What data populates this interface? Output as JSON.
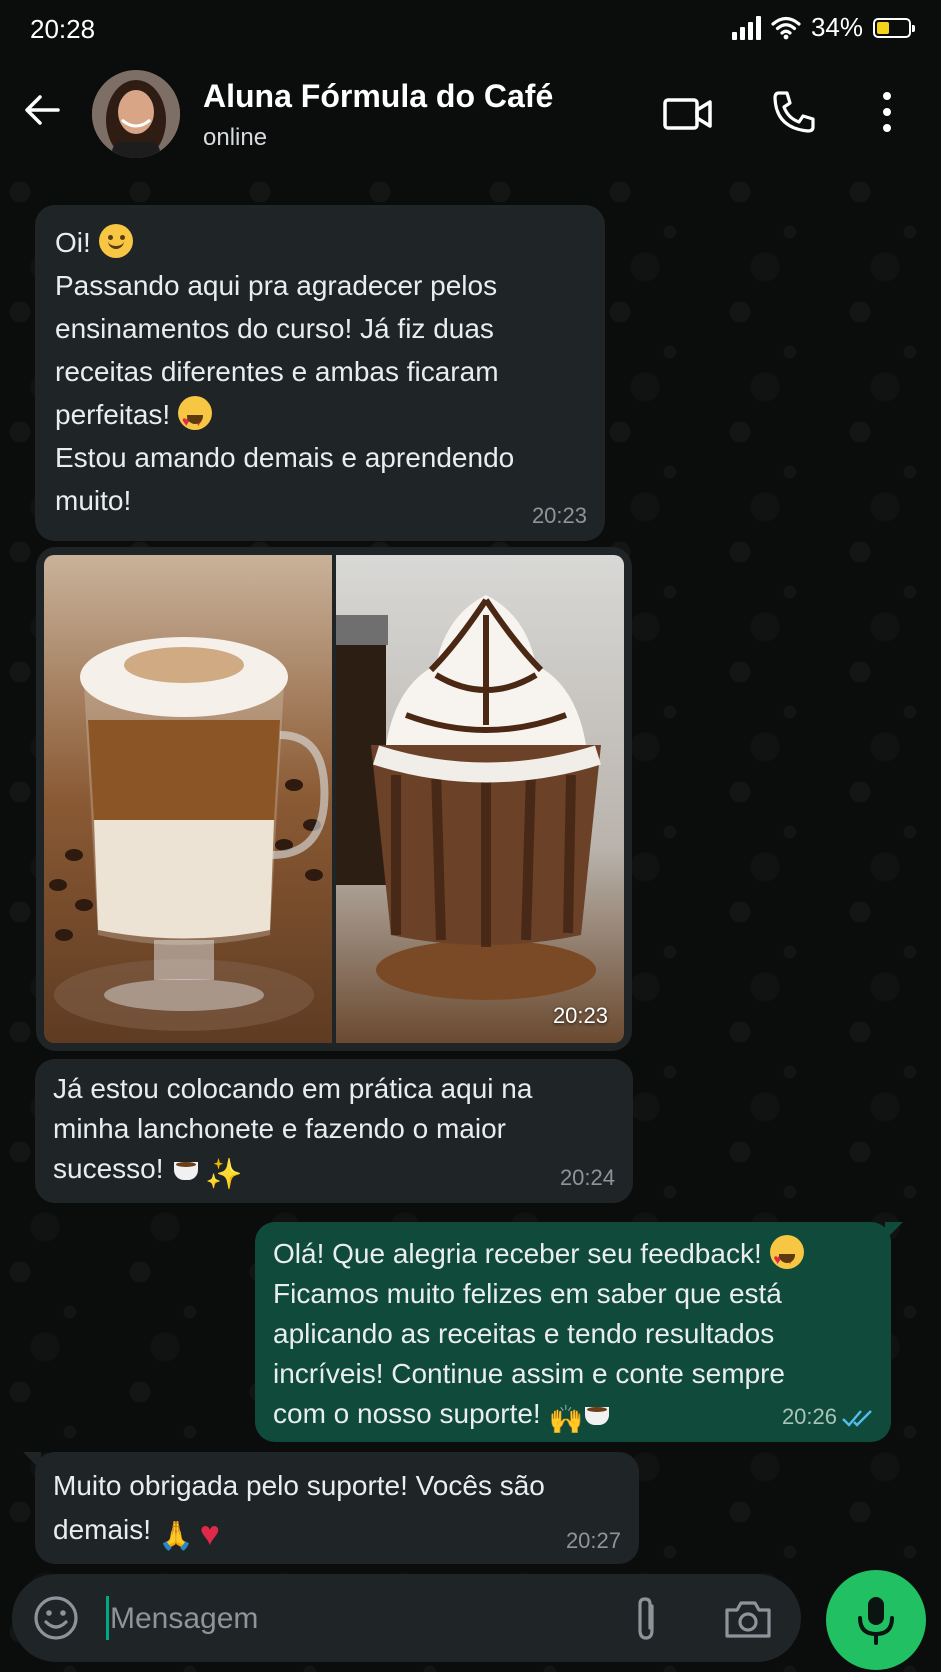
{
  "status_bar": {
    "time": "20:28",
    "battery": "34%"
  },
  "header": {
    "contact_name": "Aluna Fórmula do Café",
    "contact_status": "online"
  },
  "messages": [
    {
      "direction": "incoming",
      "lines": [
        "Oi!",
        "Passando aqui pra agradecer pelos",
        "ensinamentos do curso! Já fiz duas",
        "receitas diferentes e ambas ficaram",
        "perfeitas!",
        "Estou amando demais e aprendendo",
        "muito!"
      ],
      "time": "20:23"
    },
    {
      "direction": "incoming",
      "type": "photos",
      "time": "20:23",
      "photos": [
        "layered latte in glass mug",
        "mocha with whipped cream and chocolate"
      ]
    },
    {
      "direction": "incoming",
      "lines": [
        "Já estou colocando em prática aqui na",
        "minha lanchonete e fazendo o maior",
        "sucesso!"
      ],
      "time": "20:24"
    },
    {
      "direction": "outgoing",
      "lines": [
        "Olá! Que alegria receber seu feedback!",
        "Ficamos muito felizes em saber que está",
        "aplicando as receitas e tendo resultados",
        "incríveis! Continue assim e conte sempre",
        "com o nosso suporte!"
      ],
      "time": "20:26",
      "read": true
    },
    {
      "direction": "incoming",
      "lines": [
        "Muito obrigada pelo suporte! Vocês são",
        "demais!"
      ],
      "time": "20:27"
    }
  ],
  "input": {
    "placeholder": "Mensagem"
  },
  "colors": {
    "incoming_bubble": "#1f2427",
    "outgoing_bubble": "#0f4a3b",
    "accent": "#21c063",
    "read_ticks": "#53bdeb"
  },
  "icons": [
    "back-arrow-icon",
    "video-call-icon",
    "phone-icon",
    "more-vert-icon",
    "emoji-icon",
    "attach-icon",
    "camera-icon",
    "mic-icon"
  ]
}
